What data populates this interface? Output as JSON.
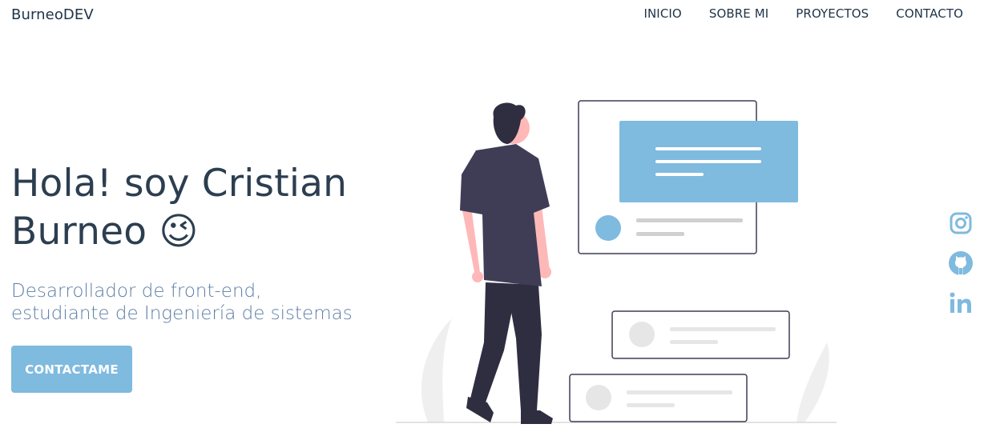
{
  "brand": "BurneoDEV",
  "nav": {
    "items": [
      {
        "label": "INICIO"
      },
      {
        "label": "SOBRE MI"
      },
      {
        "label": "PROYECTOS"
      },
      {
        "label": "CONTACTO"
      }
    ]
  },
  "hero": {
    "title_line1": "Hola! soy Cristian",
    "title_line2": "Burneo 😉",
    "subtitle_line1": "Desarrollador de front-end,",
    "subtitle_line2": "estudiante de Ingeniería de sistemas",
    "cta_label": "CONTACTAME"
  },
  "social": {
    "icons": [
      "instagram-icon",
      "github-icon",
      "linkedin-icon"
    ]
  },
  "colors": {
    "accent": "#7fbadf",
    "text": "#2c3e50",
    "subtitle": "#5d7ea5"
  }
}
